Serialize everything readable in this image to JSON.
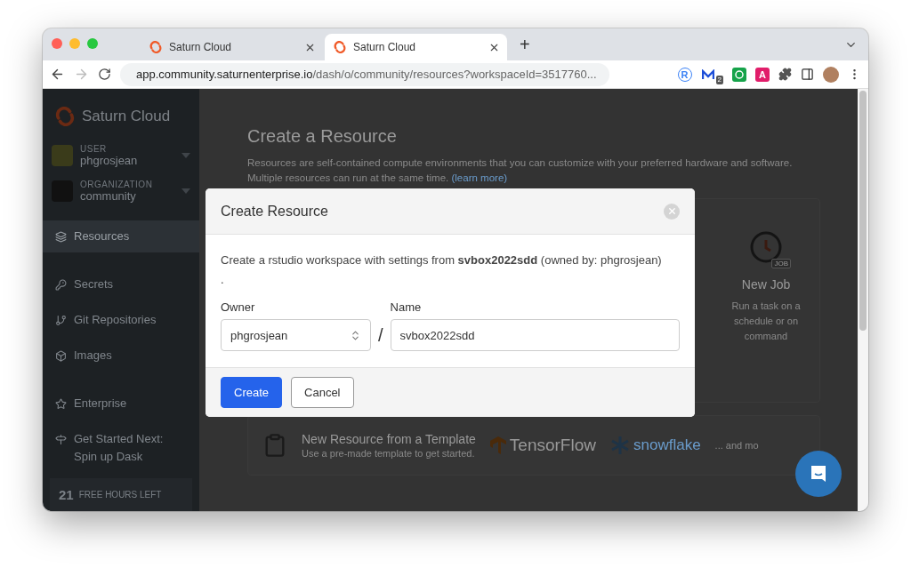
{
  "browser": {
    "tabs": [
      {
        "title": "Saturn Cloud",
        "selected": false
      },
      {
        "title": "Saturn Cloud",
        "selected": true
      }
    ],
    "new_tab": "+",
    "address": {
      "host": "app.community.saturnenterprise.io",
      "path": "/dash/o/community/resources?workspaceId=3517760..."
    },
    "extensions": [
      {
        "kind": "r",
        "label": "R"
      },
      {
        "kind": "m",
        "badge": "2"
      },
      {
        "kind": "green"
      },
      {
        "kind": "a",
        "label": "A"
      },
      {
        "kind": "puzzle"
      },
      {
        "kind": "sidebar"
      },
      {
        "kind": "avatar"
      }
    ]
  },
  "sidebar": {
    "brand": "Saturn Cloud",
    "accounts": [
      {
        "kind": "user",
        "caption": "USER",
        "name": "phgrosjean"
      },
      {
        "kind": "org",
        "caption": "ORGANIZATION",
        "name": "community"
      }
    ],
    "items": [
      {
        "label": "Resources",
        "selected": true
      },
      {
        "label": "Secrets",
        "selected": false
      },
      {
        "label": "Git Repositories",
        "selected": false
      },
      {
        "label": "Images",
        "selected": false
      },
      {
        "label": "Enterprise",
        "selected": false
      },
      {
        "label": "Get Started Next: Spin up Dask",
        "selected": false
      }
    ],
    "hours": {
      "count": "21",
      "label": "FREE HOURS LEFT"
    }
  },
  "page": {
    "title": "Create a Resource",
    "description": "Resources are self-contained compute environments that you can customize with your preferred hardware and software. Multiple resources can run at the same time.",
    "link": "(learn more)",
    "card": {
      "badge": "JOB",
      "title": "New Job",
      "text": "Run a task on a schedule or on command"
    },
    "template": {
      "title": "New Resource from a Template",
      "subtitle": "Use a pre-made template to get started.",
      "logos": [
        "TensorFlow",
        "snowflake"
      ],
      "more": "... and mo"
    }
  },
  "modal": {
    "title": "Create Resource",
    "message": "Create a rstudio workspace with settings from **svbox2022sdd** (owned by: phgrosjean)\n.",
    "owner": {
      "label": "Owner",
      "value": "phgrosjean"
    },
    "separator": "/",
    "name": {
      "label": "Name",
      "value": "svbox2022sdd"
    },
    "buttons": [
      {
        "kind": "primary",
        "label": "Create"
      },
      {
        "kind": "secondary",
        "label": "Cancel"
      }
    ]
  }
}
